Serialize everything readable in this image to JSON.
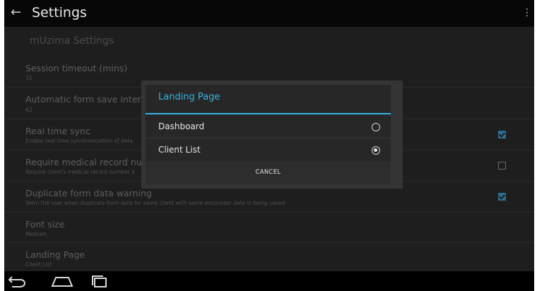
{
  "actionbar": {
    "title": "Settings",
    "back_icon": "arrow-left-icon",
    "menu_icon": "overflow-menu-icon"
  },
  "settings": {
    "category": "mUzima Settings",
    "items": [
      {
        "title": "Session timeout (mins)",
        "summary": "15"
      },
      {
        "title": "Automatic form save interval (m",
        "summary": "62"
      },
      {
        "title": "Real time sync",
        "summary": "Enable real time synchronization of data",
        "checked": true
      },
      {
        "title": "Require medical record number",
        "summary": "Require client's medical record number d",
        "checked": false
      },
      {
        "title": "Duplicate form data warning",
        "summary": "Warn the user when duplicate form data for same client with same encounter date is being saved",
        "checked": true
      },
      {
        "title": "Font size",
        "summary": "Medium"
      },
      {
        "title": "Landing Page",
        "summary": "Client List"
      }
    ]
  },
  "dialog": {
    "title": "Landing Page",
    "options": [
      {
        "label": "Dashboard",
        "selected": false
      },
      {
        "label": "Client List",
        "selected": true
      }
    ],
    "cancel_label": "CANCEL"
  },
  "navbar": {
    "back_icon": "nav-back-icon",
    "home_icon": "nav-home-icon",
    "recents_icon": "nav-recents-icon"
  },
  "colors": {
    "accent": "#33b5e5",
    "checkbox_on": "#2f6c8e",
    "background": "#191919"
  }
}
